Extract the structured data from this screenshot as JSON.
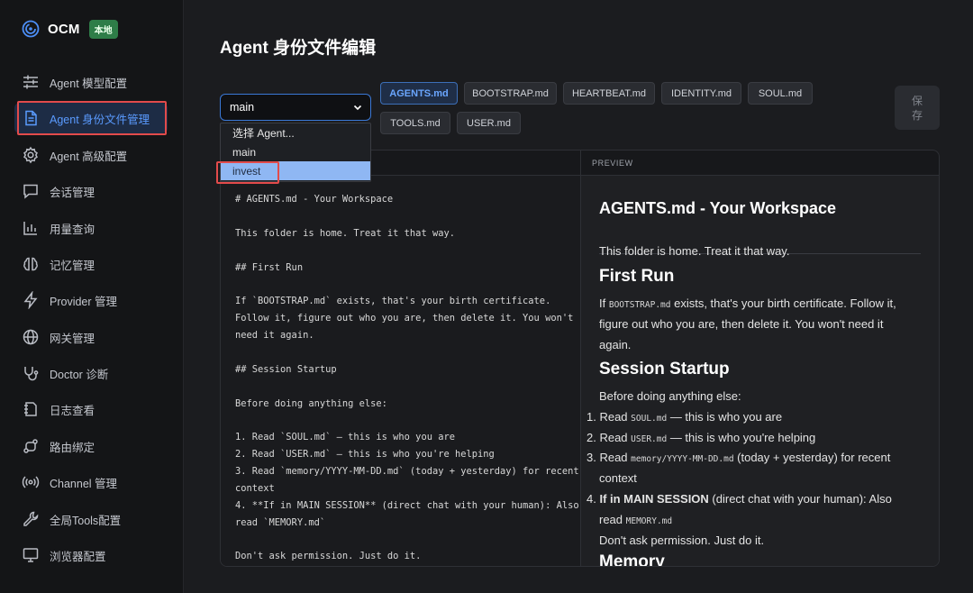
{
  "brand": {
    "name": "OCM",
    "badge": "本地"
  },
  "sidebar": {
    "items": [
      {
        "label": "Agent 模型配置",
        "icon": "sliders-icon"
      },
      {
        "label": "Agent 身份文件管理",
        "icon": "document-icon",
        "active": true
      },
      {
        "label": "Agent 高级配置",
        "icon": "gear-icon"
      },
      {
        "label": "会话管理",
        "icon": "chat-icon"
      },
      {
        "label": "用量查询",
        "icon": "bar-chart-icon"
      },
      {
        "label": "记忆管理",
        "icon": "brain-icon"
      },
      {
        "label": "Provider 管理",
        "icon": "lightning-icon"
      },
      {
        "label": "网关管理",
        "icon": "globe-icon"
      },
      {
        "label": "Doctor 诊断",
        "icon": "stethoscope-icon"
      },
      {
        "label": "日志查看",
        "icon": "log-icon"
      },
      {
        "label": "路由绑定",
        "icon": "route-icon"
      },
      {
        "label": "Channel 管理",
        "icon": "broadcast-icon"
      },
      {
        "label": "全局Tools配置",
        "icon": "wrench-icon"
      },
      {
        "label": "浏览器配置",
        "icon": "monitor-icon"
      }
    ]
  },
  "main": {
    "title": "Agent 身份文件编辑",
    "agent_select": {
      "value": "main",
      "options": [
        "选择 Agent...",
        "main",
        "invest"
      ],
      "highlighted": "invest"
    },
    "file_tabs": [
      "AGENTS.md",
      "BOOTSTRAP.md",
      "HEARTBEAT.md",
      "IDENTITY.md",
      "SOUL.md",
      "TOOLS.md",
      "USER.md"
    ],
    "active_tab": "AGENTS.md",
    "save_label": "保存",
    "preview_header": "PREVIEW",
    "editor_lines": [
      "# AGENTS.md - Your Workspace",
      "This folder is home. Treat it that way.",
      "## First Run",
      "If `BOOTSTRAP.md` exists, that's your birth certificate.",
      "Follow it, figure out who you are, then delete it. You won't",
      "need it again.",
      "## Session Startup",
      "Before doing anything else:",
      "1. Read `SOUL.md` — this is who you are",
      "2. Read `USER.md` — this is who you're helping",
      "3. Read `memory/YYYY-MM-DD.md` (today + yesterday) for recent",
      "context",
      "4. **If in MAIN SESSION** (direct chat with your human): Also",
      "read `MEMORY.md`",
      "Don't ask permission. Just do it."
    ],
    "preview": {
      "h1": "AGENTS.md - Your Workspace",
      "intro": "This folder is home. Treat it that way.",
      "h2_first_run": "First Run",
      "first_run_1_pre": "If ",
      "first_run_1_code": "BOOTSTRAP.md",
      "first_run_1_post": " exists, that's your birth certificate. Follow it,",
      "first_run_2": "figure out who you are, then delete it. You won't need it",
      "first_run_3": "again.",
      "h2_session": "Session Startup",
      "before": "Before doing anything else:",
      "li1_pre": "1. Read ",
      "li1_code": "SOUL.md",
      "li1_post": " — this is who you are",
      "li2_pre": "2. Read ",
      "li2_code": "USER.md",
      "li2_post": " — this is who you're helping",
      "li3_pre": "3. Read ",
      "li3_code": "memory/YYYY-MM-DD.md",
      "li3_post": " (today + yesterday) for recent",
      "li3_cont": "context",
      "li4_pre": "4. ",
      "li4_bold": "If in MAIN SESSION",
      "li4_post": " (direct chat with your human): Also",
      "li4_cont_pre": "read ",
      "li4_cont_code": "MEMORY.md",
      "dont_ask": "Don't ask permission. Just do it.",
      "h2_memory_partial": "Memory"
    }
  },
  "colors": {
    "accent": "#5a9bff",
    "highlight_box": "#e24b4b",
    "badge": "#2e7d48"
  }
}
